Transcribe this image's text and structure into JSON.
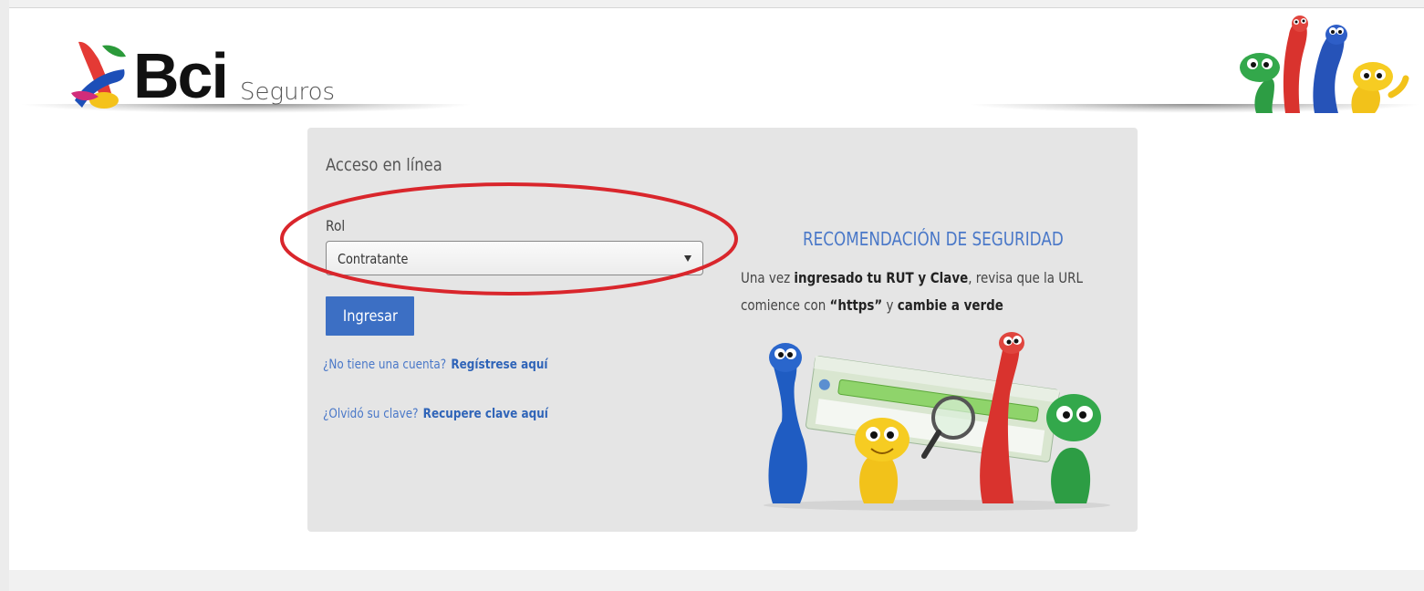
{
  "brand": {
    "name": "Bci",
    "subtitle": "Seguros"
  },
  "login": {
    "title": "Acceso en línea",
    "role_label": "Rol",
    "role_selected": "Contratante",
    "submit_label": "Ingresar",
    "register_question": "¿No tiene una cuenta?",
    "register_link": "Regístrese aquí",
    "recover_question": "¿Olvidó su clave?",
    "recover_link": "Recupere clave aquí"
  },
  "security": {
    "title": "RECOMENDACIÓN DE SEGURIDAD",
    "text_1": "Una vez ",
    "text_2": "ingresado tu RUT y Clave",
    "text_3": ", revisa que la URL comience con ",
    "text_4": "“https”",
    "text_5": " y ",
    "text_6": "cambie a verde"
  },
  "colors": {
    "accent": "#3c6fc4",
    "panel": "#e5e5e5",
    "highlight": "#d9262c"
  }
}
